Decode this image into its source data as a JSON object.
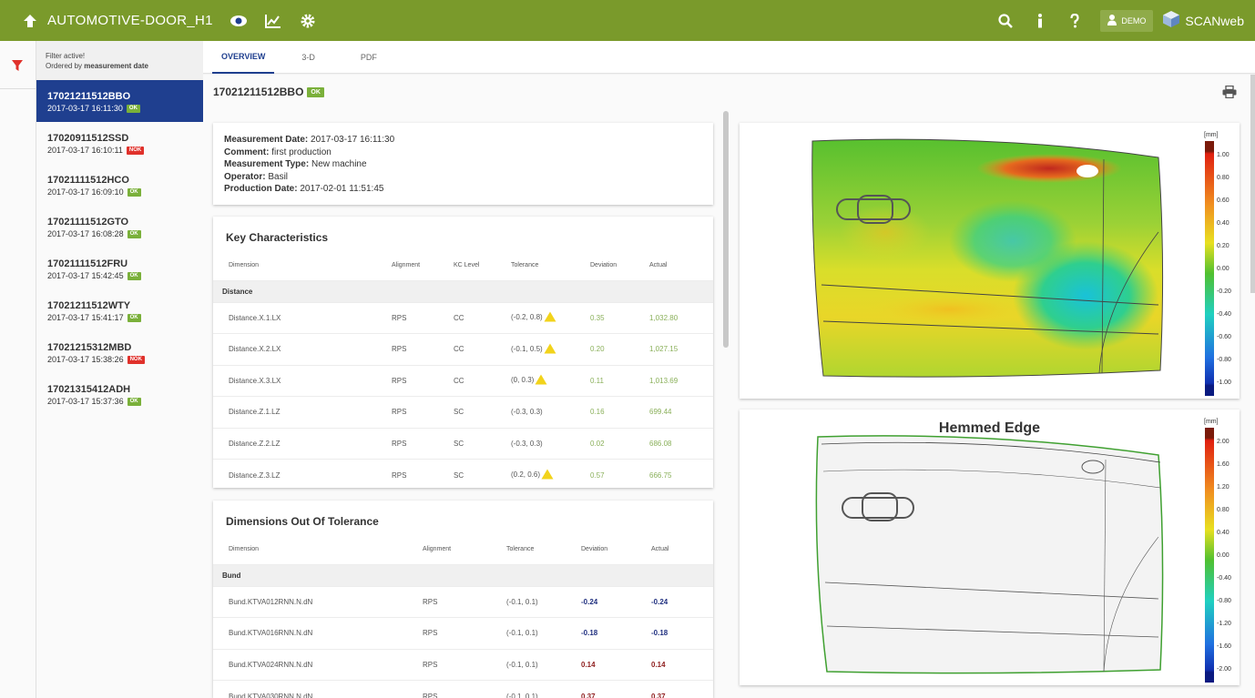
{
  "app": {
    "title": "AUTOMOTIVE-DOOR_H1",
    "user": "DEMO",
    "brand": "SCANweb",
    "accent": "#7a9a2b",
    "nav_color": "#1f3f8f"
  },
  "filter": {
    "line1": "Filter active!",
    "line2_prefix": "Ordered by ",
    "line2_bold": "measurement date"
  },
  "list": [
    {
      "id": "17021211512BBO",
      "date": "2017-03-17 16:11:30",
      "status": "OK"
    },
    {
      "id": "17020911512SSD",
      "date": "2017-03-17 16:10:11",
      "status": "NOK"
    },
    {
      "id": "17021111512HCO",
      "date": "2017-03-17 16:09:10",
      "status": "OK"
    },
    {
      "id": "17021111512GTO",
      "date": "2017-03-17 16:08:28",
      "status": "OK"
    },
    {
      "id": "17021111512FRU",
      "date": "2017-03-17 15:42:45",
      "status": "OK"
    },
    {
      "id": "17021211512WTY",
      "date": "2017-03-17 15:41:17",
      "status": "OK"
    },
    {
      "id": "17021215312MBD",
      "date": "2017-03-17 15:38:26",
      "status": "NOK"
    },
    {
      "id": "17021315412ADH",
      "date": "2017-03-17 15:37:36",
      "status": "OK"
    }
  ],
  "tabs": [
    "OVERVIEW",
    "3-D",
    "PDF"
  ],
  "header": {
    "id": "17021211512BBO",
    "status": "OK"
  },
  "info": {
    "date_label": "Measurement Date:",
    "date": "2017-03-17 16:11:30",
    "comment_label": "Comment:",
    "comment": "first production",
    "type_label": "Measurement Type:",
    "type": "New machine",
    "operator_label": "Operator:",
    "operator": "Basil",
    "prod_label": "Production Date:",
    "prod": "2017-02-01 11:51:45"
  },
  "kc": {
    "title": "Key Characteristics",
    "columns": [
      "Dimension",
      "Alignment",
      "KC Level",
      "Tolerance",
      "Deviation",
      "Actual"
    ],
    "group": "Distance",
    "rows": [
      {
        "dim": "Distance.X.1.LX",
        "align": "RPS",
        "level": "CC",
        "tol": "(-0.2, 0.8)",
        "warn": true,
        "dev": "0.35",
        "act": "1,032.80"
      },
      {
        "dim": "Distance.X.2.LX",
        "align": "RPS",
        "level": "CC",
        "tol": "(-0.1, 0.5)",
        "warn": true,
        "dev": "0.20",
        "act": "1,027.15"
      },
      {
        "dim": "Distance.X.3.LX",
        "align": "RPS",
        "level": "CC",
        "tol": "(0, 0.3)",
        "warn": true,
        "dev": "0.11",
        "act": "1,013.69"
      },
      {
        "dim": "Distance.Z.1.LZ",
        "align": "RPS",
        "level": "SC",
        "tol": "(-0.3, 0.3)",
        "warn": false,
        "dev": "0.16",
        "act": "699.44"
      },
      {
        "dim": "Distance.Z.2.LZ",
        "align": "RPS",
        "level": "SC",
        "tol": "(-0.3, 0.3)",
        "warn": false,
        "dev": "0.02",
        "act": "686.08"
      },
      {
        "dim": "Distance.Z.3.LZ",
        "align": "RPS",
        "level": "SC",
        "tol": "(0.2, 0.6)",
        "warn": true,
        "dev": "0.57",
        "act": "666.75"
      }
    ]
  },
  "dot": {
    "title": "Dimensions Out Of Tolerance",
    "columns": [
      "Dimension",
      "Alignment",
      "Tolerance",
      "Deviation",
      "Actual"
    ],
    "group": "Bund",
    "rows": [
      {
        "dim": "Bund.KTVA012RNN.N.dN",
        "align": "RPS",
        "tol": "(-0.1, 0.1)",
        "dev": "-0.24",
        "act": "-0.24",
        "sign": "neg"
      },
      {
        "dim": "Bund.KTVA016RNN.N.dN",
        "align": "RPS",
        "tol": "(-0.1, 0.1)",
        "dev": "-0.18",
        "act": "-0.18",
        "sign": "neg"
      },
      {
        "dim": "Bund.KTVA024RNN.N.dN",
        "align": "RPS",
        "tol": "(-0.1, 0.1)",
        "dev": "0.14",
        "act": "0.14",
        "sign": "pos"
      },
      {
        "dim": "Bund.KTVA030RNN.N.dN",
        "align": "RPS",
        "tol": "(-0.1, 0.1)",
        "dev": "0.37",
        "act": "0.37",
        "sign": "pos"
      }
    ]
  },
  "legend1": {
    "unit": "[mm]",
    "labels": [
      "1.00",
      "0.80",
      "0.60",
      "0.40",
      "0.20",
      "0.00",
      "-0.20",
      "-0.40",
      "-0.60",
      "-0.80",
      "-1.00"
    ]
  },
  "legend2": {
    "title": "Hemmed Edge",
    "unit": "[mm]",
    "labels": [
      "2.00",
      "1.60",
      "1.20",
      "0.80",
      "0.40",
      "0.00",
      "-0.40",
      "-0.80",
      "-1.20",
      "-1.60",
      "-2.00"
    ]
  }
}
